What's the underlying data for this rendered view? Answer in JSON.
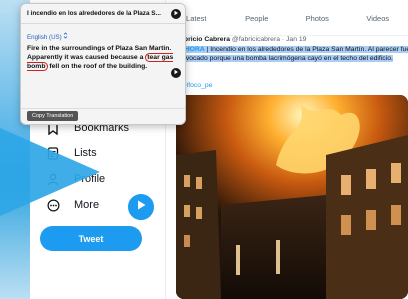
{
  "popup": {
    "source_text": "I incendio en los alrededores de la Plaza S...",
    "target_language": "English (US)",
    "translation_before": "Fire in the surroundings of Plaza San Martin. Apparently it was caused because a ",
    "translation_circled": "tear gas bomb",
    "translation_after": " fell on the roof of the building.",
    "copy_button": "Copy Translation",
    "play_icon": "play-icon",
    "next_icon": "next-icon"
  },
  "sidebar": {
    "items": [
      {
        "label": "Bookmarks",
        "icon": "bookmark-icon"
      },
      {
        "label": "Lists",
        "icon": "list-icon"
      },
      {
        "label": "Profile",
        "icon": "profile-icon"
      },
      {
        "label": "More",
        "icon": "more-icon"
      }
    ],
    "tweet_button": "Tweet"
  },
  "tabs": [
    "Latest",
    "People",
    "Photos",
    "Videos"
  ],
  "tweet": {
    "author": "Fabricio Cabrera",
    "meta": "@fabricicabrera · Jan 19",
    "hashtag": "#AHORA",
    "body": " | Incendio en los alrededores de la Plaza San Martín. Al parecer fue provocado porque una bomba lacrimógena cayó en el techo del edificio.",
    "mention": "@elfoco_pe"
  },
  "colors": {
    "accent": "#1d9bf0",
    "highlight": "#a9cdf4",
    "arrow": "#2ea6e6"
  }
}
